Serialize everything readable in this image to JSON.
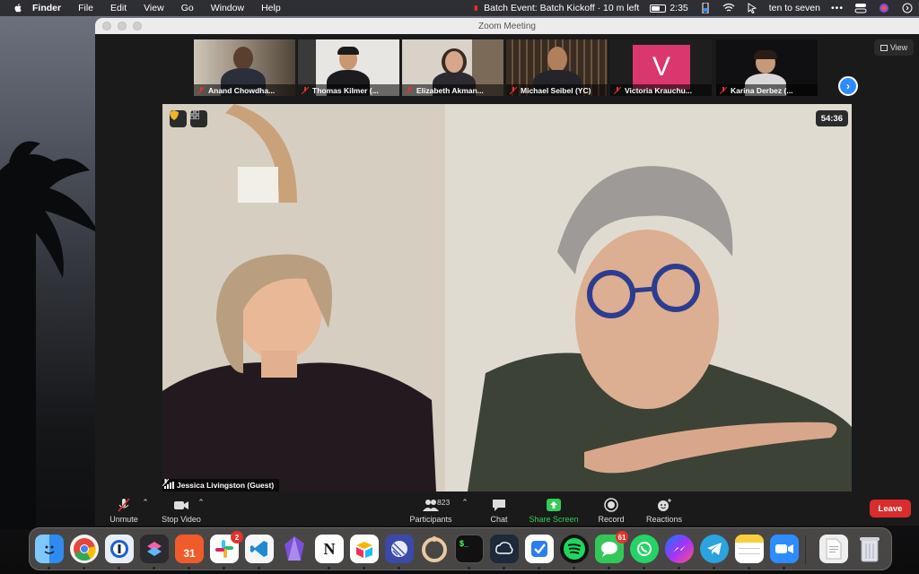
{
  "menubar": {
    "app_name": "Finder",
    "menus": [
      "File",
      "Edit",
      "View",
      "Go",
      "Window",
      "Help"
    ],
    "event_reminder": "Batch Event: Batch Kickoff · 10 m left",
    "clock": "2:35",
    "time_text": "ten to seven"
  },
  "window": {
    "title": "Zoom Meeting",
    "view_label": "View",
    "timer": "54:36",
    "active_speaker": "Jessica Livingston (Guest)"
  },
  "participants_strip": [
    {
      "name": "Anand Chowdha..."
    },
    {
      "name": "Thomas Kilmer (..."
    },
    {
      "name": "Elizabeth Akman..."
    },
    {
      "name": "Michael Seibel (YC)"
    },
    {
      "name": "Victoria Krauchu...",
      "initial": "V"
    },
    {
      "name": "Karina Derbez (..."
    }
  ],
  "toolbar": {
    "unmute": "Unmute",
    "stop_video": "Stop Video",
    "participants": "Participants",
    "participant_count": "823",
    "chat": "Chat",
    "share_screen": "Share Screen",
    "record": "Record",
    "reactions": "Reactions",
    "leave": "Leave"
  },
  "dock": {
    "apps": [
      "finder",
      "chrome",
      "1password",
      "shortcuts",
      "calendar",
      "slack",
      "vscode",
      "obsidian",
      "notion",
      "airtable",
      "linear",
      "notchmeister",
      "terminal",
      "chatgpt",
      "things",
      "spotify",
      "messages",
      "whatsapp",
      "messenger",
      "telegram",
      "notes",
      "zoom",
      "preview",
      "trash"
    ],
    "calendar_date": "31",
    "slack_badge": "2",
    "messages_badge": "61"
  },
  "colors": {
    "share_green": "#33cc55",
    "leave_red": "#d92c2c",
    "zoom_blue": "#2d8cff",
    "avatar_pink": "#d9376e"
  }
}
